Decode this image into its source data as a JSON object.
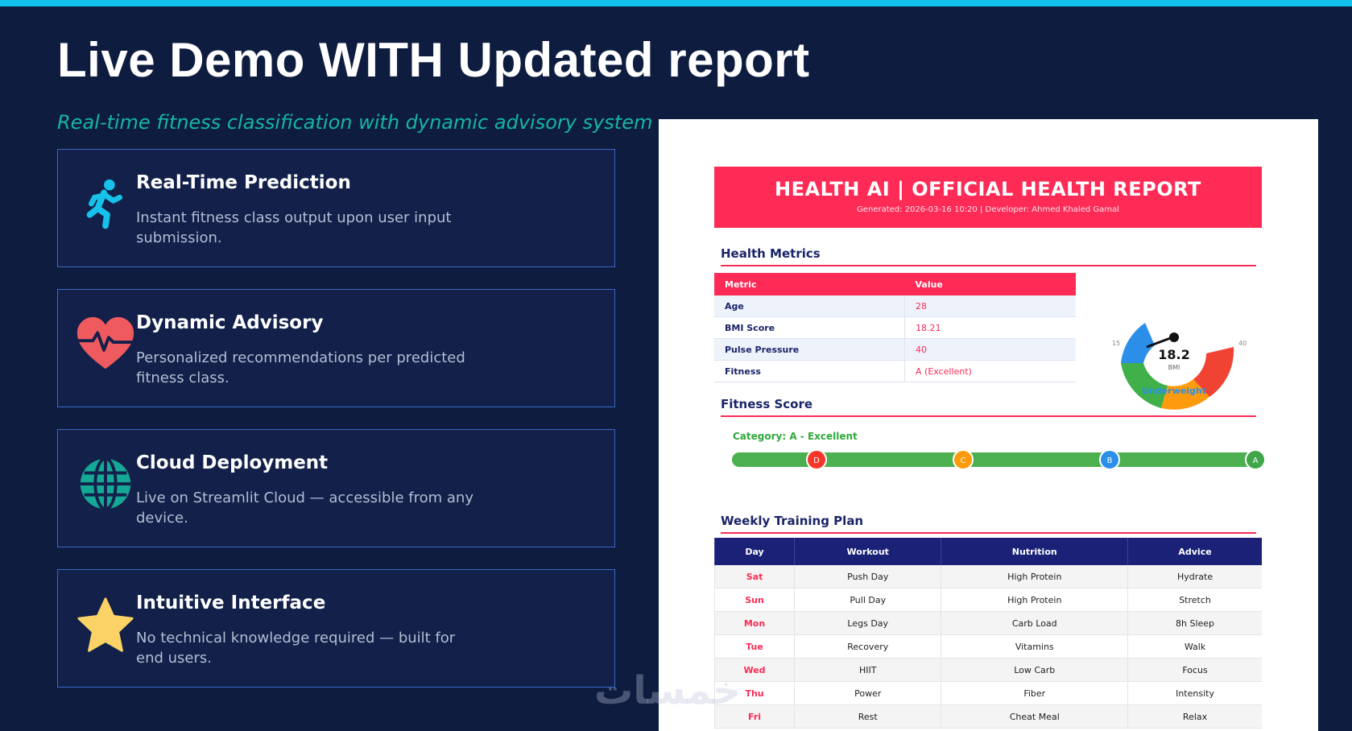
{
  "slide": {
    "title": "Live Demo WITH Updated report",
    "subtitle": "Real-time fitness classification with dynamic advisory system"
  },
  "cards": [
    {
      "icon": "running-person-icon",
      "title": "Real-Time Prediction",
      "desc": "Instant fitness class output upon user input submission."
    },
    {
      "icon": "heartbeat-icon",
      "title": "Dynamic Advisory",
      "desc": "Personalized recommendations per predicted fitness class."
    },
    {
      "icon": "globe-icon",
      "title": "Cloud Deployment",
      "desc": "Live on Streamlit Cloud — accessible from any device."
    },
    {
      "icon": "star-icon",
      "title": "Intuitive Interface",
      "desc": "No technical knowledge required — built for end users."
    }
  ],
  "report": {
    "title": "HEALTH AI | OFFICIAL HEALTH REPORT",
    "generated": "Generated: 2026-03-16 10:20 | Developer: Ahmed Khaled Gamal",
    "metrics_heading": "Health Metrics",
    "metrics_cols": [
      "Metric",
      "Value"
    ],
    "metrics": [
      [
        "Age",
        "28"
      ],
      [
        "BMI Score",
        "18.21"
      ],
      [
        "Pulse Pressure",
        "40"
      ],
      [
        "Fitness",
        "A (Excellent)"
      ]
    ],
    "gauge": {
      "value": "18.2",
      "unit": "BMI",
      "min": "15",
      "max": "40",
      "status": "Underweight",
      "bmi": 18.21
    },
    "fitness_heading": "Fitness Score",
    "fitness_category": "Category: A - Excellent",
    "grades": [
      "D",
      "C",
      "B",
      "A"
    ],
    "plan_heading": "Weekly Training Plan",
    "plan_cols": [
      "Day",
      "Workout",
      "Nutrition",
      "Advice"
    ],
    "plan": [
      [
        "Sat",
        "Push Day",
        "High Protein",
        "Hydrate"
      ],
      [
        "Sun",
        "Pull Day",
        "High Protein",
        "Stretch"
      ],
      [
        "Mon",
        "Legs Day",
        "Carb Load",
        "8h Sleep"
      ],
      [
        "Tue",
        "Recovery",
        "Vitamins",
        "Walk"
      ],
      [
        "Wed",
        "HIIT",
        "Low Carb",
        "Focus"
      ],
      [
        "Thu",
        "Power",
        "Fiber",
        "Intensity"
      ],
      [
        "Fri",
        "Rest",
        "Cheat Meal",
        "Relax"
      ]
    ]
  },
  "colors": {
    "accent": "#11c3ec",
    "brand": "#fd2b56",
    "navy": "#1a2177",
    "teal": "#16b6a2"
  },
  "watermark": "خمسات"
}
